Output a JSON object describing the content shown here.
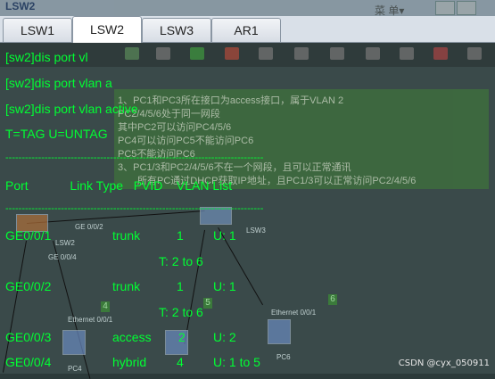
{
  "window": {
    "title": "LSW2",
    "menu_label": "菜 单▾"
  },
  "tabs": [
    {
      "label": "LSW1",
      "active": false
    },
    {
      "label": "LSW2",
      "active": true
    },
    {
      "label": "LSW3",
      "active": false
    },
    {
      "label": "AR1",
      "active": false
    }
  ],
  "topology": {
    "note_lines": [
      "1、PC1和PC3所在接口为access接口，属于VLAN 2",
      "PC2/4/5/6处于同一网段",
      "其中PC2可以访问PC4/5/6",
      "PC4可以访问PC5不能访问PC6",
      "PC5不能访问PC6",
      "3、PC1/3和PC2/4/5/6不在一个网段，且可以正常通讯",
      "所有PC通过DHCP获取IP地址，且PC1/3可以正常访问PC2/4/5/6"
    ],
    "labels": {
      "lsw3": "LSW3",
      "lsw2": "LSW2",
      "ge_a": "GE 0/0/2",
      "ge_b": "GE 0/0/4",
      "eth_a": "Ethernet 0/0/1",
      "eth_b": "Ethernet 0/0/1",
      "pc4": "PC4",
      "pc6": "PC6",
      "tag4": "4",
      "tag5": "5",
      "tag6": "6"
    }
  },
  "console": {
    "lines": [
      "[sw2]dis port vl",
      "[sw2]dis port vlan a",
      "[sw2]dis port vlan active",
      "T=TAG U=UNTAG",
      "-------------------------------------------------------------------------------",
      "Port            Link Type   PVID    VLAN List",
      "-------------------------------------------------------------------------------"
    ],
    "rows": [
      {
        "port": "GE0/0/1",
        "type": "trunk",
        "pvid": "1",
        "vlans": "U: 1",
        "extra": "T: 2 to 6"
      },
      {
        "port": "GE0/0/2",
        "type": "trunk",
        "pvid": "1",
        "vlans": "U: 1",
        "extra": "T: 2 to 6"
      },
      {
        "port": "GE0/0/3",
        "type": "access",
        "pvid": "2",
        "vlans": "U: 2",
        "extra": ""
      },
      {
        "port": "GE0/0/4",
        "type": "hybrid",
        "pvid": "4",
        "vlans": "U: 1 to 5",
        "extra": ""
      }
    ]
  },
  "watermark": "CSDN @cyx_050911"
}
